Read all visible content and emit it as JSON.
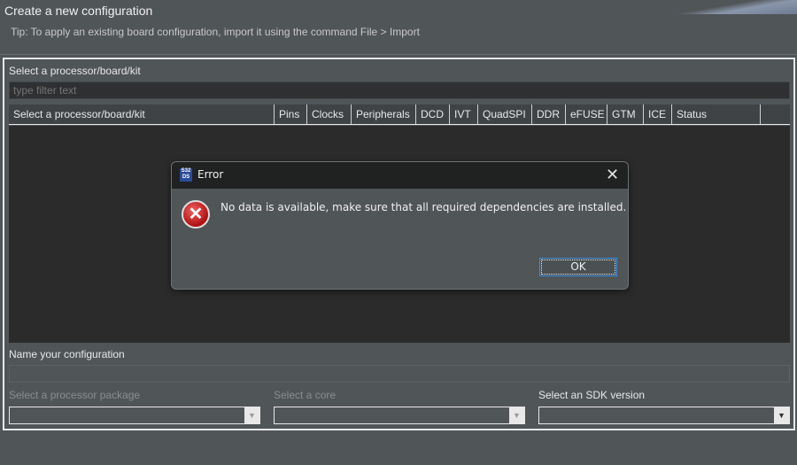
{
  "header": {
    "title": "Create a new configuration",
    "tip": "Tip: To apply an existing board configuration, import it using the command File > Import"
  },
  "selector": {
    "label": "Select a processor/board/kit",
    "filter_placeholder": "type filter text",
    "columns": [
      "Select a processor/board/kit",
      "Pins",
      "Clocks",
      "Peripherals",
      "DCD",
      "IVT",
      "QuadSPI",
      "DDR",
      "eFUSE",
      "GTM",
      "ICE",
      "Status"
    ]
  },
  "config": {
    "name_label": "Name your configuration",
    "name_value": "",
    "package_label": "Select a processor package",
    "core_label": "Select a core",
    "sdk_label": "Select an SDK version"
  },
  "dialog": {
    "icon_text": "S32 DS",
    "title": "Error",
    "message": "No data is available, make sure that all required dependencies are installed.",
    "ok_label": "OK"
  }
}
